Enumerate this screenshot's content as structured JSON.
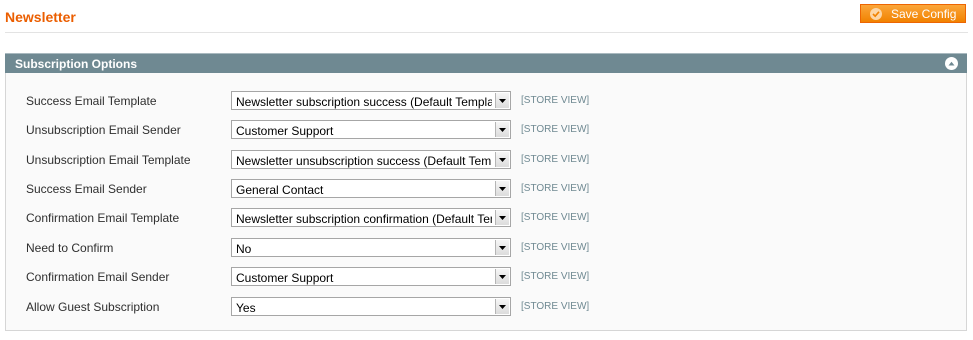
{
  "page": {
    "title": "Newsletter",
    "save_label": "Save Config"
  },
  "section": {
    "title": "Subscription Options",
    "scope_label": "[STORE VIEW]",
    "fields": [
      {
        "label": "Success Email Template",
        "value": "Newsletter subscription success (Default Template from Locale)"
      },
      {
        "label": "Unsubscription Email Sender",
        "value": "Customer Support"
      },
      {
        "label": "Unsubscription Email Template",
        "value": "Newsletter unsubscription success (Default Template from Locale)"
      },
      {
        "label": "Success Email Sender",
        "value": "General Contact"
      },
      {
        "label": "Confirmation Email Template",
        "value": "Newsletter subscription confirmation (Default Template from Locale)"
      },
      {
        "label": "Need to Confirm",
        "value": "No"
      },
      {
        "label": "Confirmation Email Sender",
        "value": "Customer Support"
      },
      {
        "label": "Allow Guest Subscription",
        "value": "Yes"
      }
    ]
  },
  "colors": {
    "title_orange": "#eb5e00",
    "button_orange": "#f18200",
    "section_header": "#6f8992"
  },
  "icons": {
    "save": "checkmark-circle-icon",
    "collapse": "collapse-up-icon",
    "dropdown": "chevron-down-icon"
  }
}
